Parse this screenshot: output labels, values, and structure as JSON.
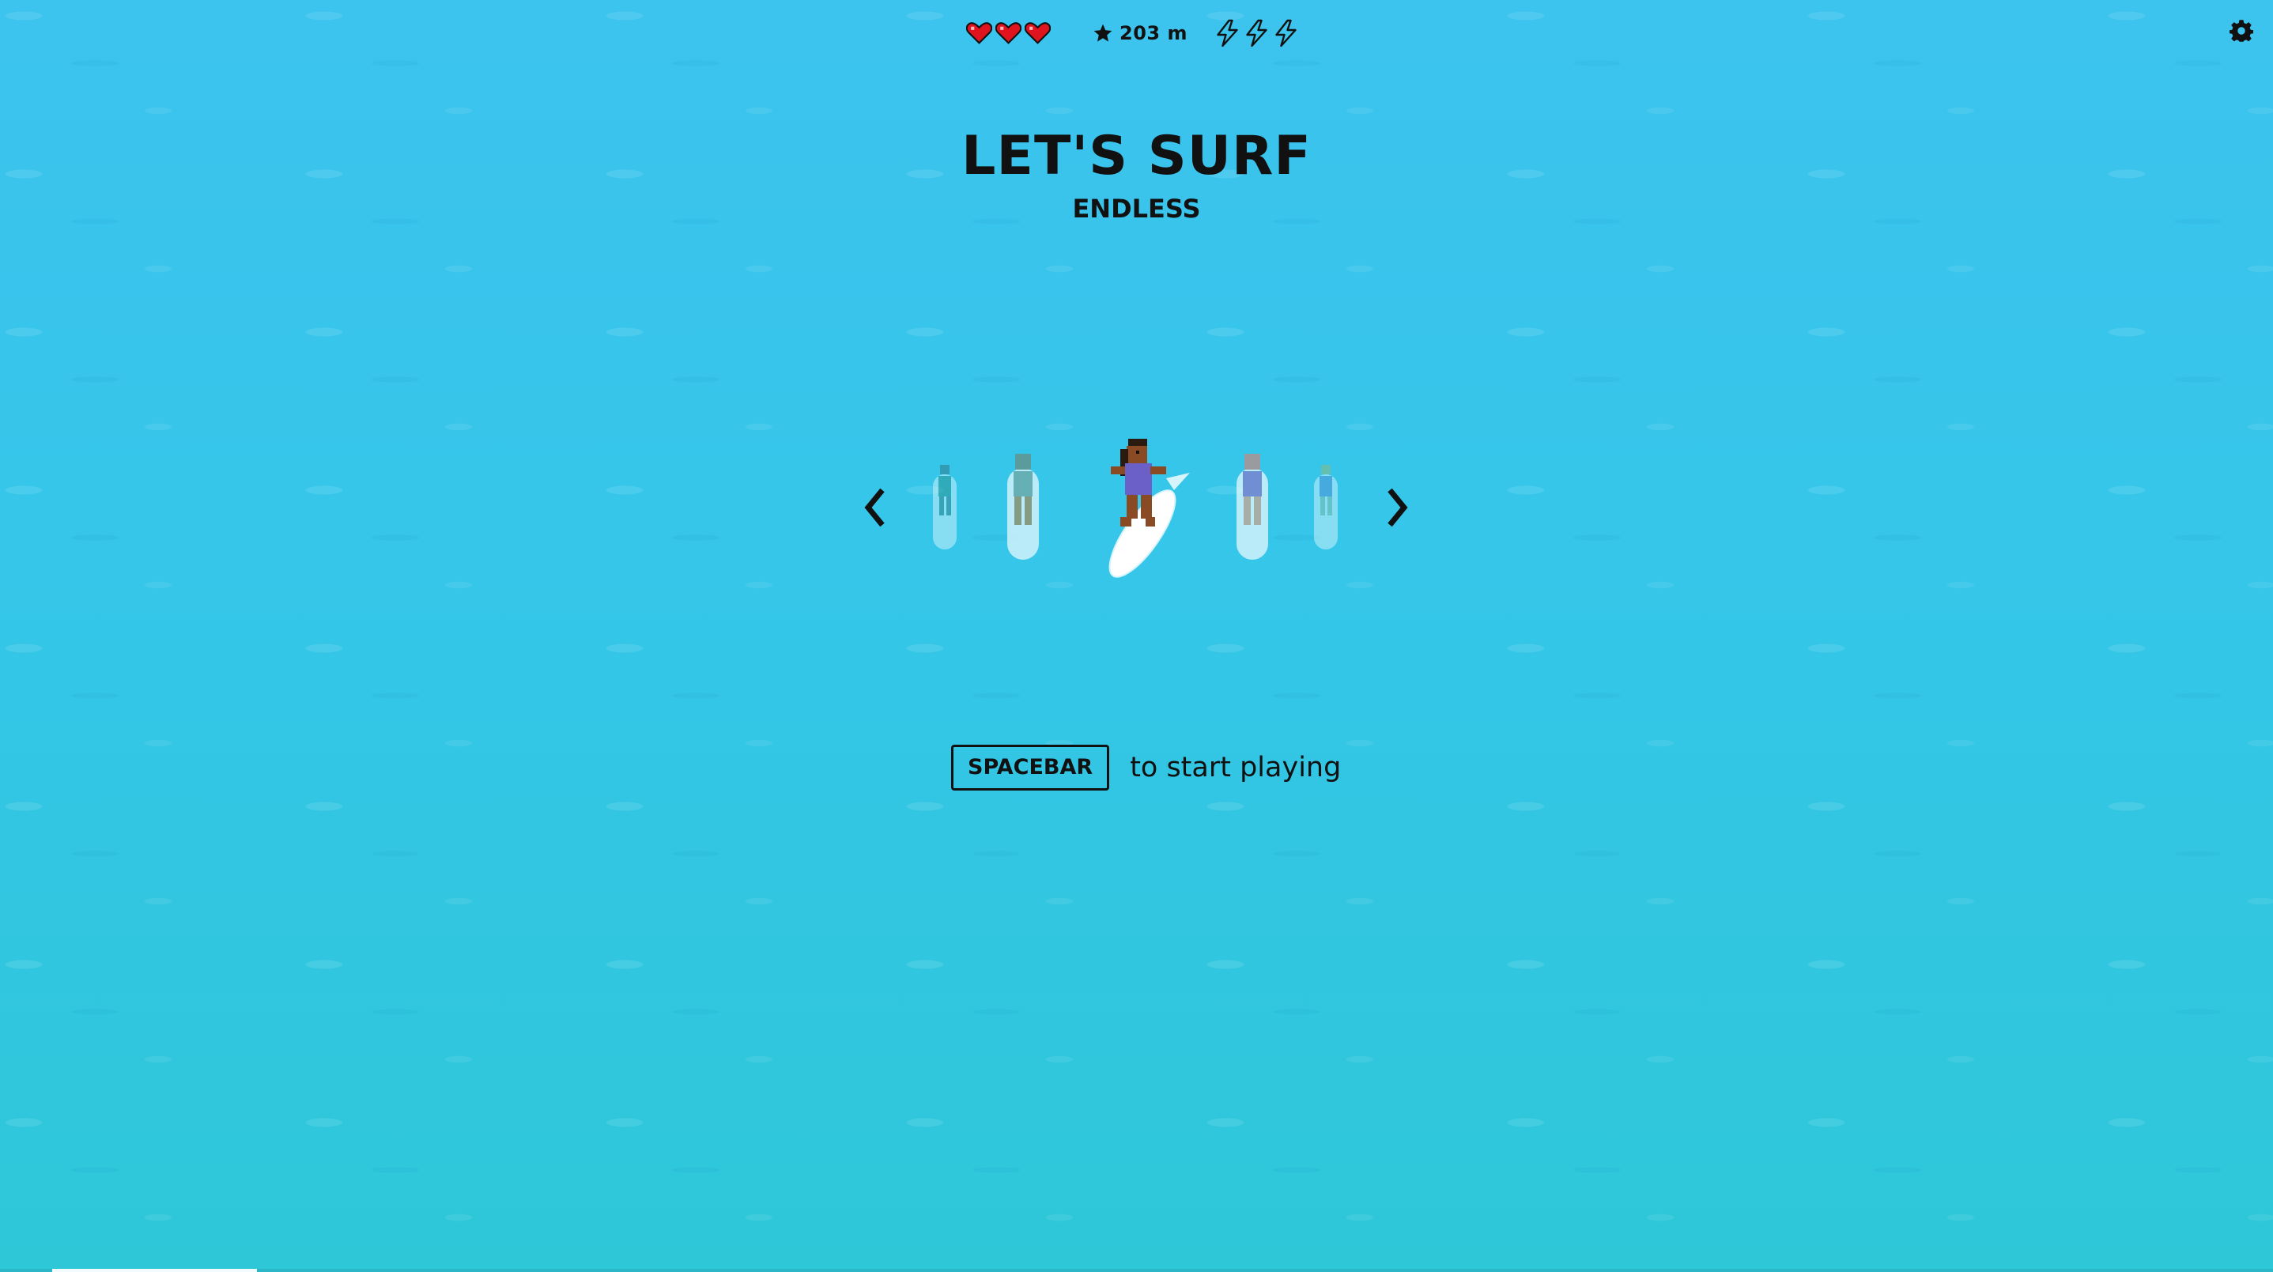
{
  "hud": {
    "hearts": 3,
    "distance": "203 m",
    "boosts": 3
  },
  "title": "LET'S SURF",
  "mode": "ENDLESS",
  "start": {
    "key": "SPACEBAR",
    "text": "to start playing"
  },
  "icons": {
    "heart": "heart-icon",
    "star": "star-icon",
    "boost": "lightning-icon",
    "settings": "gear-icon",
    "prev": "chevron-left-icon",
    "next": "chevron-right-icon"
  },
  "colors": {
    "heart": "#e0141e",
    "water": "#35c6e9",
    "text": "#111111"
  },
  "loading_progress": 0.09
}
